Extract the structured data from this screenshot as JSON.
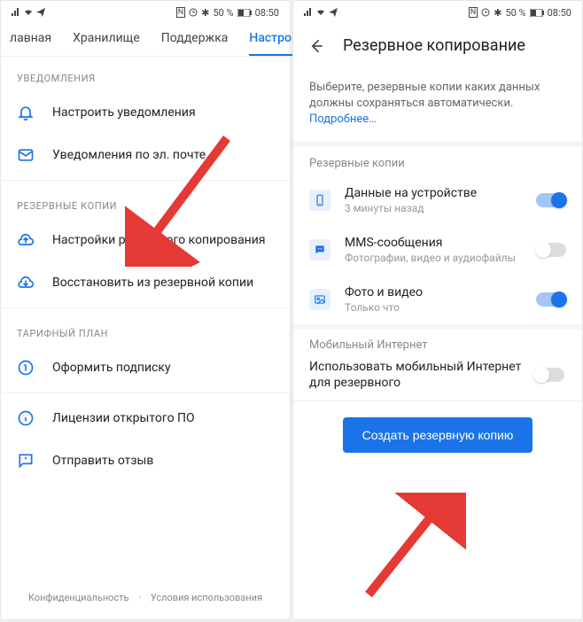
{
  "status": {
    "battery": "50 %",
    "time": "08:50"
  },
  "left": {
    "tabs": [
      "лавная",
      "Хранилище",
      "Поддержка",
      "Настройки"
    ],
    "active_tab": 3,
    "sections": {
      "notifications": {
        "header": "УВЕДОМЛЕНИЯ",
        "items": [
          {
            "id": "config-notif",
            "icon": "bell-icon",
            "label": "Настроить уведомления"
          },
          {
            "id": "email-notif",
            "icon": "mail-icon",
            "label": "Уведомления по эл. почте"
          }
        ]
      },
      "backup": {
        "header": "РЕЗЕРВНЫЕ КОПИИ",
        "items": [
          {
            "id": "backup-settings",
            "icon": "cloud-up-icon",
            "label": "Настройки резервного копирования"
          },
          {
            "id": "restore",
            "icon": "cloud-down-icon",
            "label": "Восстановить из резервной копии"
          }
        ]
      },
      "plan": {
        "header": "ТАРИФНЫЙ ПЛАН",
        "items": [
          {
            "id": "subscribe",
            "icon": "one-icon",
            "label": "Оформить подписку"
          }
        ]
      },
      "about": {
        "items": [
          {
            "id": "licenses",
            "icon": "info-icon",
            "label": "Лицензии открытого ПО"
          },
          {
            "id": "feedback",
            "icon": "feedback-icon",
            "label": "Отправить отзыв"
          }
        ]
      }
    },
    "footer": {
      "privacy": "Конфиденциальность",
      "dot": "·",
      "tos": "Условия использования"
    }
  },
  "right": {
    "title": "Резервное копирование",
    "intro": "Выберите, резервные копии каких данных должны сохраняться автоматически.",
    "learn_more": "Подробнее…",
    "backups_header": "Резервные копии",
    "items": [
      {
        "id": "device-data",
        "icon": "phone-icon",
        "title": "Данные на устройстве",
        "subtitle": "3 минуты назад",
        "on": true
      },
      {
        "id": "mms",
        "icon": "mms-icon",
        "title": "MMS-сообщения",
        "subtitle": "Фотографии, видео и аудиофайлы",
        "on": false
      },
      {
        "id": "photos",
        "icon": "photos-icon",
        "title": "Фото и видео",
        "subtitle": "Только что",
        "on": true
      }
    ],
    "mobile_header": "Мобильный Интернет",
    "mobile_label": "Использовать мобильный Интернет для резервного",
    "mobile_on": false,
    "button": "Создать резервную копию"
  }
}
